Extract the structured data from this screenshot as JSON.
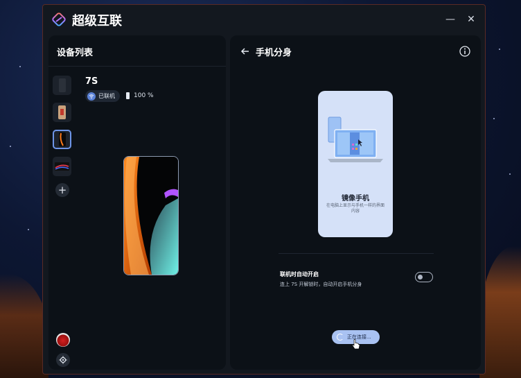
{
  "app": {
    "title": "超级互联",
    "minimize_icon": "minimize-icon",
    "close_icon": "close-icon"
  },
  "device_list": {
    "title": "设备列表",
    "selected_device": {
      "name": "7S",
      "status": "已联机",
      "battery": "100 %"
    },
    "add_icon": "plus-icon",
    "settings_icon": "gear-icon"
  },
  "mirror": {
    "title": "手机分身",
    "card_title": "镜像手机",
    "card_desc": "在电脑上显示与手机一样的界面内容",
    "auto_label": "联机时自动开启",
    "auto_desc": "连上 7S 开解锁时，自动开启手机分身",
    "auto_enabled": false,
    "connecting_label": "正在连接..."
  },
  "colors": {
    "accent": "#5c83d9",
    "button_bg": "#a9c2f2",
    "card_bg": "#d5e1f8"
  }
}
